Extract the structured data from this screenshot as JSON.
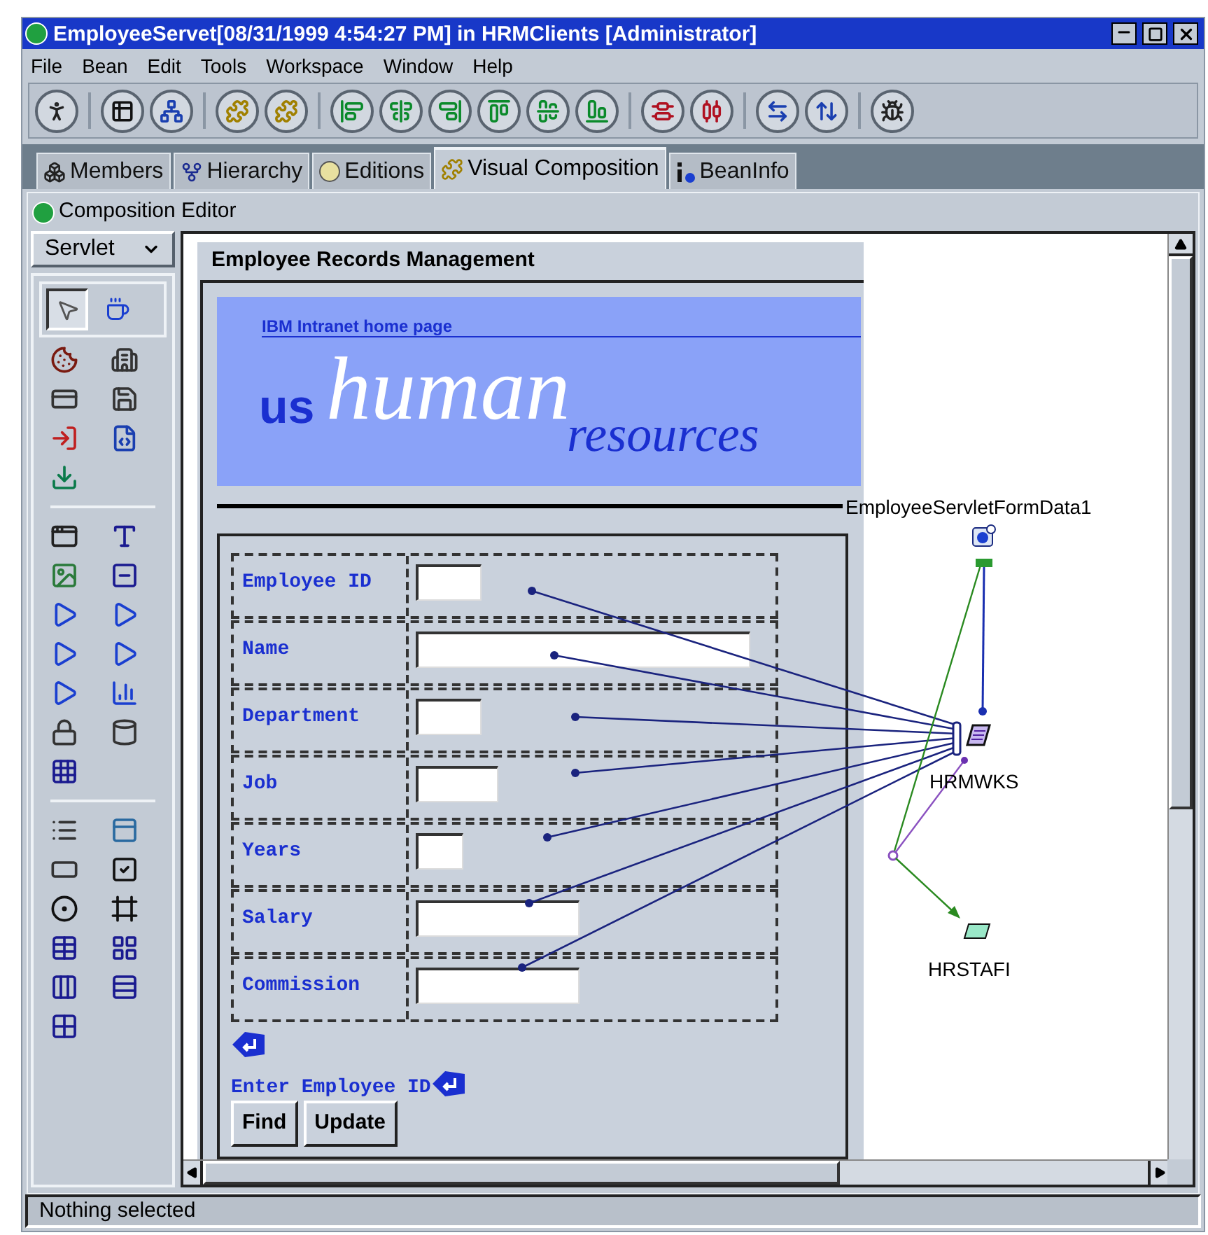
{
  "window": {
    "title": "EmployeeServet[08/31/1999 4:54:27 PM] in HRMClients [Administrator]"
  },
  "menu": [
    {
      "label": "File"
    },
    {
      "label": "Bean"
    },
    {
      "label": "Edit"
    },
    {
      "label": "Tools"
    },
    {
      "label": "Workspace"
    },
    {
      "label": "Window"
    },
    {
      "label": "Help"
    }
  ],
  "tabs": [
    {
      "label": "Members",
      "selected": false
    },
    {
      "label": "Hierarchy",
      "selected": false
    },
    {
      "label": "Editions",
      "selected": false
    },
    {
      "label": "Visual Composition",
      "selected": true
    },
    {
      "label": "BeanInfo",
      "selected": false
    }
  ],
  "editor": {
    "title": "Composition Editor",
    "palette_category": "Servlet"
  },
  "selection_tools": [
    {
      "selected": true
    },
    {
      "selected": false
    }
  ],
  "form": {
    "title": "Employee Records Management",
    "banner": {
      "link": "IBM Intranet home page",
      "prefix": "us",
      "headline": "human",
      "subline": "resources"
    },
    "fields": [
      {
        "label": "Employee ID"
      },
      {
        "label": "Name"
      },
      {
        "label": "Department"
      },
      {
        "label": "Job"
      },
      {
        "label": "Years"
      },
      {
        "label": "Salary"
      },
      {
        "label": "Commission"
      }
    ],
    "prompt": "Enter Employee ID",
    "buttons": [
      {
        "label": "Find"
      },
      {
        "label": "Update"
      }
    ]
  },
  "beans": [
    {
      "kind": "form_data",
      "label": "EmployeeServletFormData1"
    },
    {
      "kind": "record",
      "label": "HRMWKS"
    },
    {
      "kind": "file",
      "label": "HRSTAFI"
    }
  ],
  "status_bar": {
    "text": "Nothing selected"
  }
}
